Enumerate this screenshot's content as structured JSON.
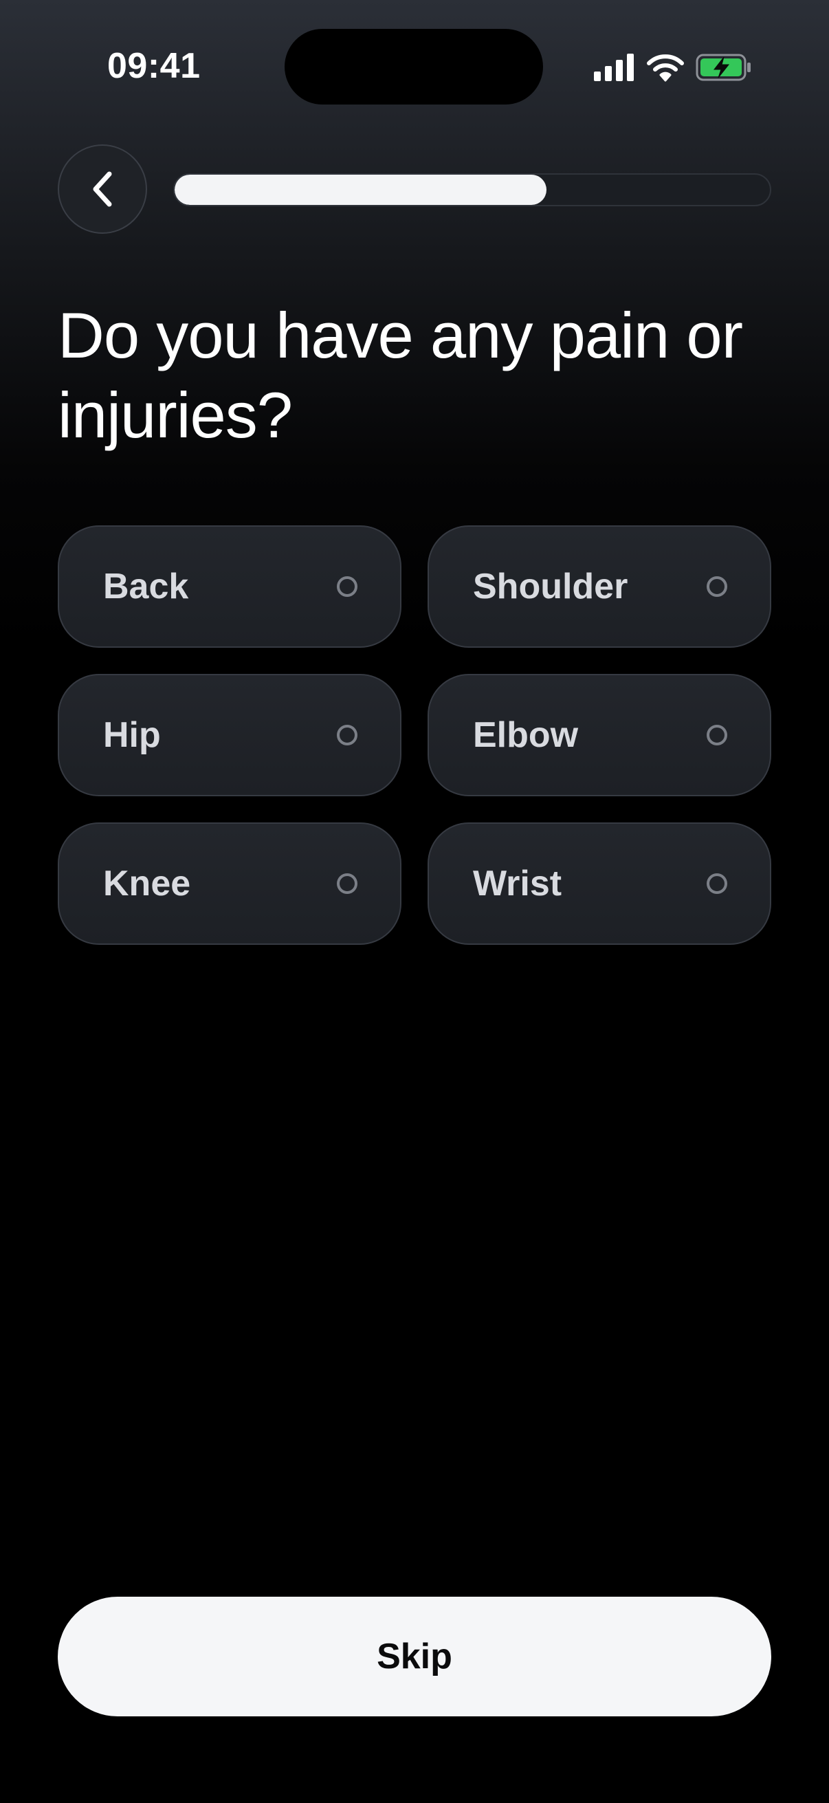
{
  "status_bar": {
    "time": "09:41",
    "icons": [
      "cellular-signal-icon",
      "wifi-icon",
      "battery-charging-icon"
    ]
  },
  "nav": {
    "back_icon": "chevron-left-icon",
    "progress_fraction": 0.625
  },
  "question": {
    "title": "Do you have any pain or injuries?"
  },
  "options": [
    {
      "label": "Back",
      "selected": false
    },
    {
      "label": "Shoulder",
      "selected": false
    },
    {
      "label": "Hip",
      "selected": false
    },
    {
      "label": "Elbow",
      "selected": false
    },
    {
      "label": "Knee",
      "selected": false
    },
    {
      "label": "Wrist",
      "selected": false
    }
  ],
  "footer": {
    "skip_label": "Skip"
  },
  "colors": {
    "battery_green": "#34c759",
    "button_bg": "#f5f6f8",
    "card_bg": "#23262c"
  }
}
